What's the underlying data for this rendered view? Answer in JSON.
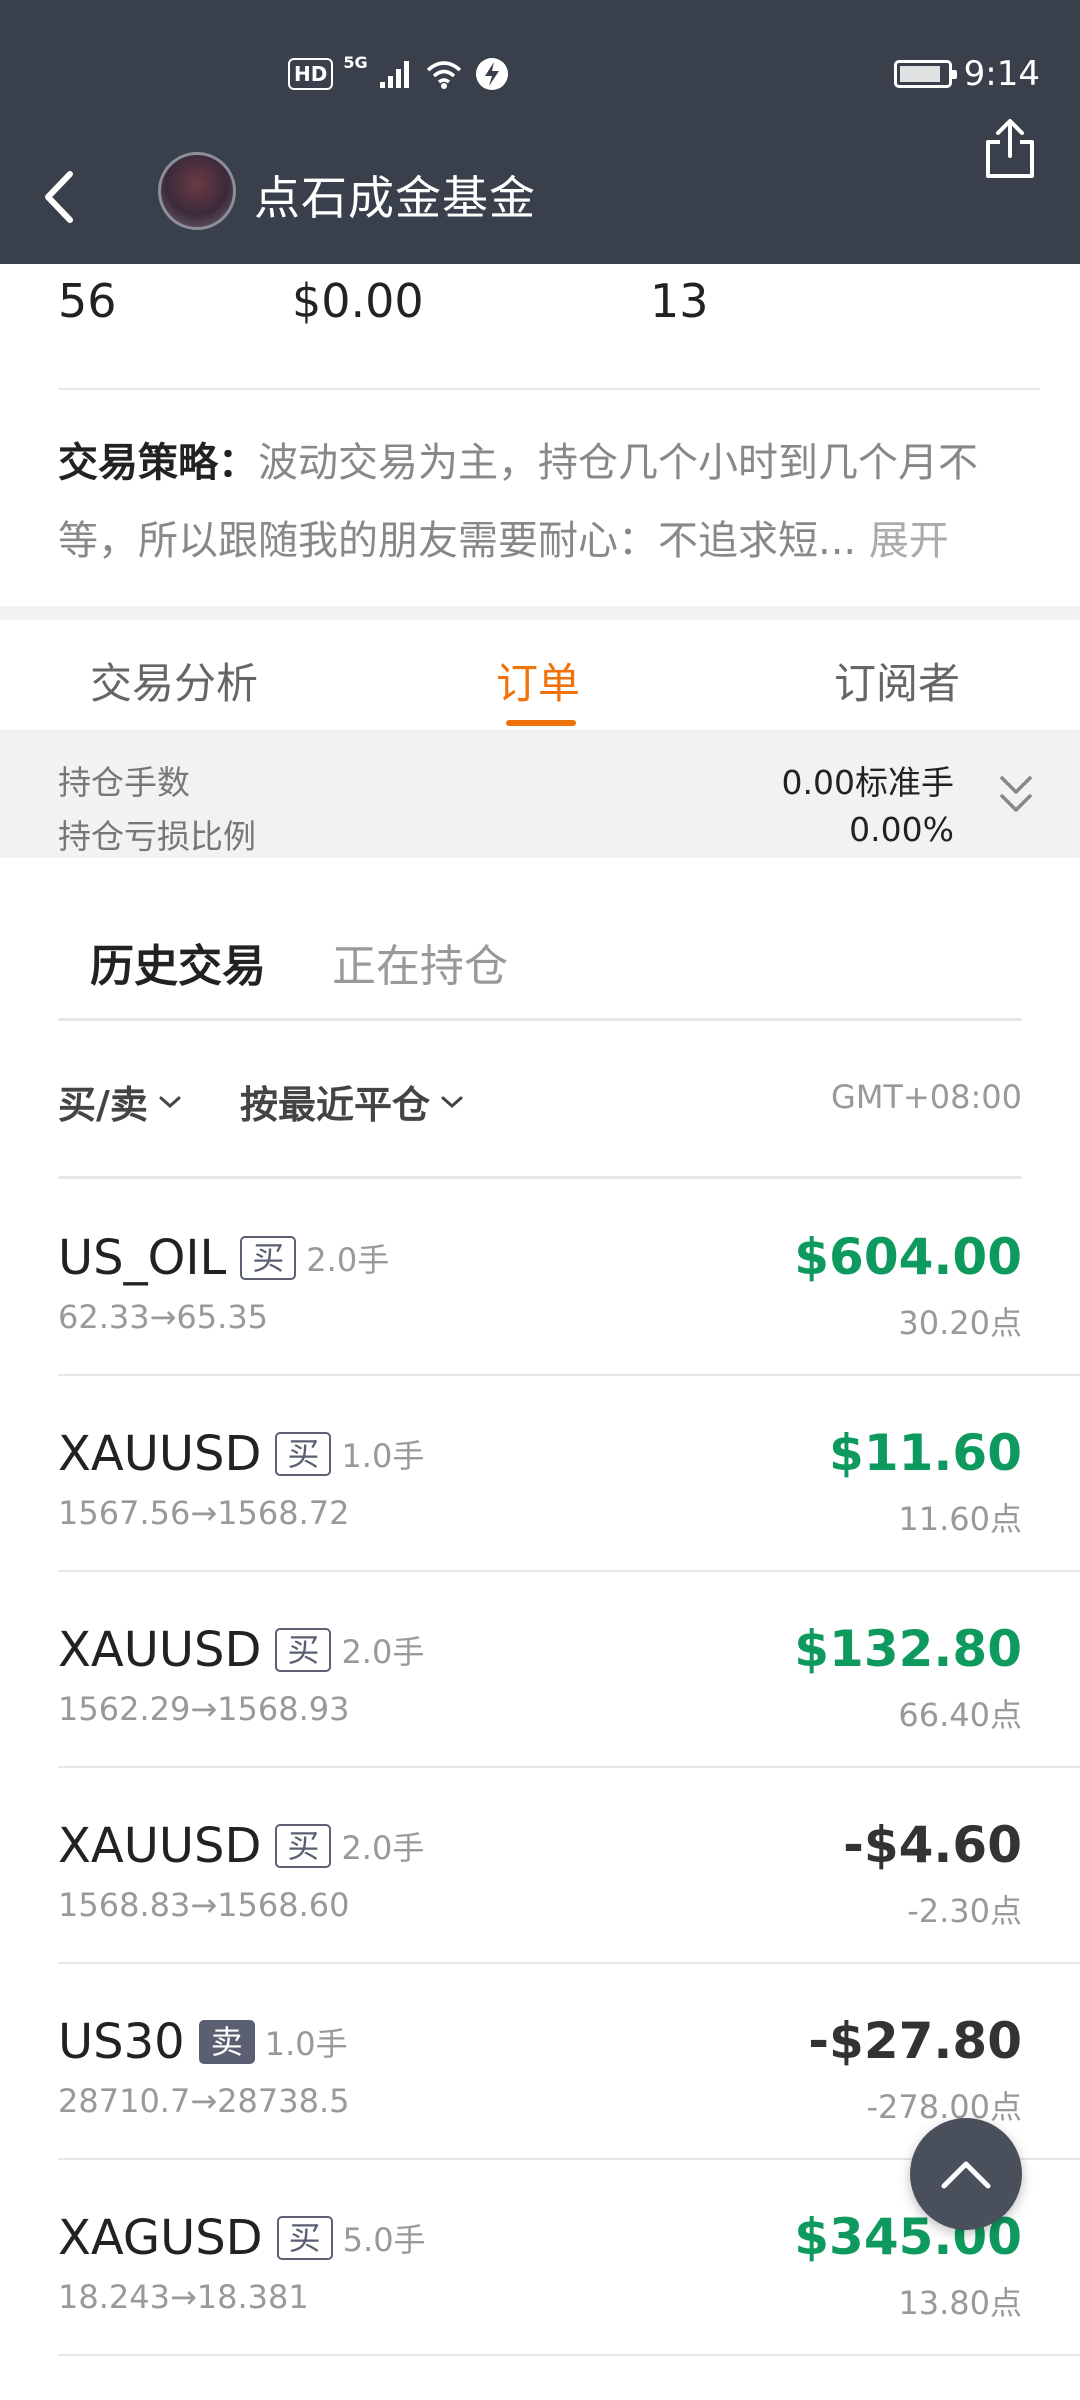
{
  "status_bar": {
    "hd": "HD",
    "network": "5G",
    "time": "9:14"
  },
  "header": {
    "title": "点石成金基金"
  },
  "stats": {
    "value_1": "56",
    "value_2": "$0.00",
    "value_3": "13"
  },
  "strategy": {
    "label": "交易策略：",
    "text": "波动交易为主，持仓几个小时到几个月不等，所以跟随我的朋友需要耐心：不追求短...",
    "expand": "展开"
  },
  "tabs": [
    {
      "label": "交易分析",
      "active": false
    },
    {
      "label": "订单",
      "active": true
    },
    {
      "label": "订阅者",
      "active": false
    }
  ],
  "summary": {
    "lots_label": "持仓手数",
    "lots_value": "0.00标准手",
    "pl_ratio_label": "持仓亏损比例",
    "pl_ratio_value": "0.00%"
  },
  "subtabs": [
    {
      "label": "历史交易",
      "active": true
    },
    {
      "label": "正在持仓",
      "active": false
    }
  ],
  "filters": {
    "side": "买/卖",
    "sort": "按最近平仓",
    "timezone": "GMT+08:00"
  },
  "trades": [
    {
      "symbol": "US_OIL",
      "side": "买",
      "lots": "2.0手",
      "prices": "62.33→65.35",
      "pnl": "$604.00",
      "points": "30.20点",
      "positive": true
    },
    {
      "symbol": "XAUUSD",
      "side": "买",
      "lots": "1.0手",
      "prices": "1567.56→1568.72",
      "pnl": "$11.60",
      "points": "11.60点",
      "positive": true
    },
    {
      "symbol": "XAUUSD",
      "side": "买",
      "lots": "2.0手",
      "prices": "1562.29→1568.93",
      "pnl": "$132.80",
      "points": "66.40点",
      "positive": true
    },
    {
      "symbol": "XAUUSD",
      "side": "买",
      "lots": "2.0手",
      "prices": "1568.83→1568.60",
      "pnl": "-$4.60",
      "points": "-2.30点",
      "positive": false
    },
    {
      "symbol": "US30",
      "side": "卖",
      "lots": "1.0手",
      "prices": "28710.7→28738.5",
      "pnl": "-$27.80",
      "points": "-278.00点",
      "positive": false
    },
    {
      "symbol": "XAGUSD",
      "side": "买",
      "lots": "5.0手",
      "prices": "18.243→18.381",
      "pnl": "$345.00",
      "points": "13.80点",
      "positive": true
    }
  ],
  "colors": {
    "header_bg": "#3a404b",
    "accent": "#f0720a",
    "profit": "#0e9a5e"
  }
}
